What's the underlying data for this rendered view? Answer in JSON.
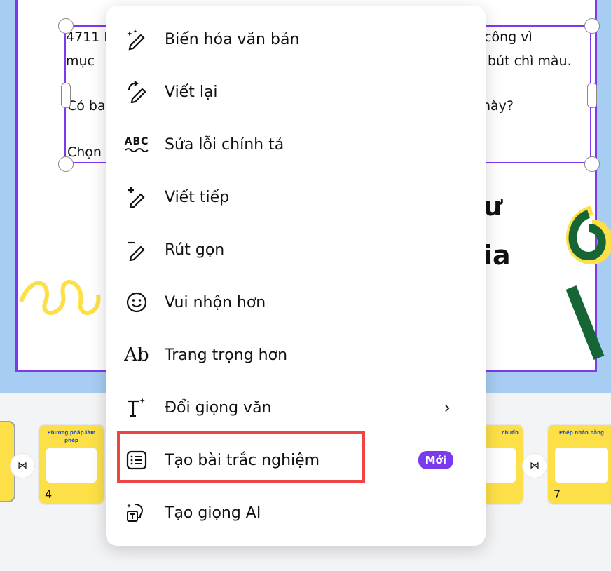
{
  "canvas": {
    "text_line1_left": "4711 l",
    "text_line1_right": "công vì",
    "text_line2_left": "mục",
    "text_line2_right": "bút chì màu.",
    "text_line3_left": "Có ba",
    "text_line3_right": "này?",
    "text_line4_left": "Chọn",
    "big_text_1": "ư",
    "big_text_2": "ia"
  },
  "thumbnails": [
    {
      "number": "4",
      "title": "Phương pháp làm phép"
    },
    {
      "number": "7",
      "title": "Phép nhân bằng"
    }
  ],
  "thumb_partial_title": "chuẩn",
  "transition_icon": "bowtie-icon",
  "menu": {
    "items": [
      {
        "label": "Biến hóa văn bản",
        "icon": "magic-pencil-icon"
      },
      {
        "label": "Viết lại",
        "icon": "rewrite-pencil-icon"
      },
      {
        "label": "Sửa lỗi chính tả",
        "icon": "spellcheck-icon"
      },
      {
        "label": "Viết tiếp",
        "icon": "continue-pencil-icon"
      },
      {
        "label": "Rút gọn",
        "icon": "shorten-pencil-icon"
      },
      {
        "label": "Vui nhộn hơn",
        "icon": "smiley-icon"
      },
      {
        "label": "Trang trọng hơn",
        "icon": "formal-text-icon"
      },
      {
        "label": "Đổi giọng văn",
        "icon": "text-tone-icon"
      },
      {
        "label": "Tạo bài trắc nghiệm",
        "icon": "quiz-list-icon"
      },
      {
        "label": "Tạo giọng AI",
        "icon": "ai-voice-icon"
      }
    ],
    "new_badge": "Mới",
    "abc_glyph": "ABC",
    "ab_glyph": "Ab",
    "chevron": "›"
  },
  "colors": {
    "accent": "#7c3aed",
    "highlight": "#ef4444"
  }
}
